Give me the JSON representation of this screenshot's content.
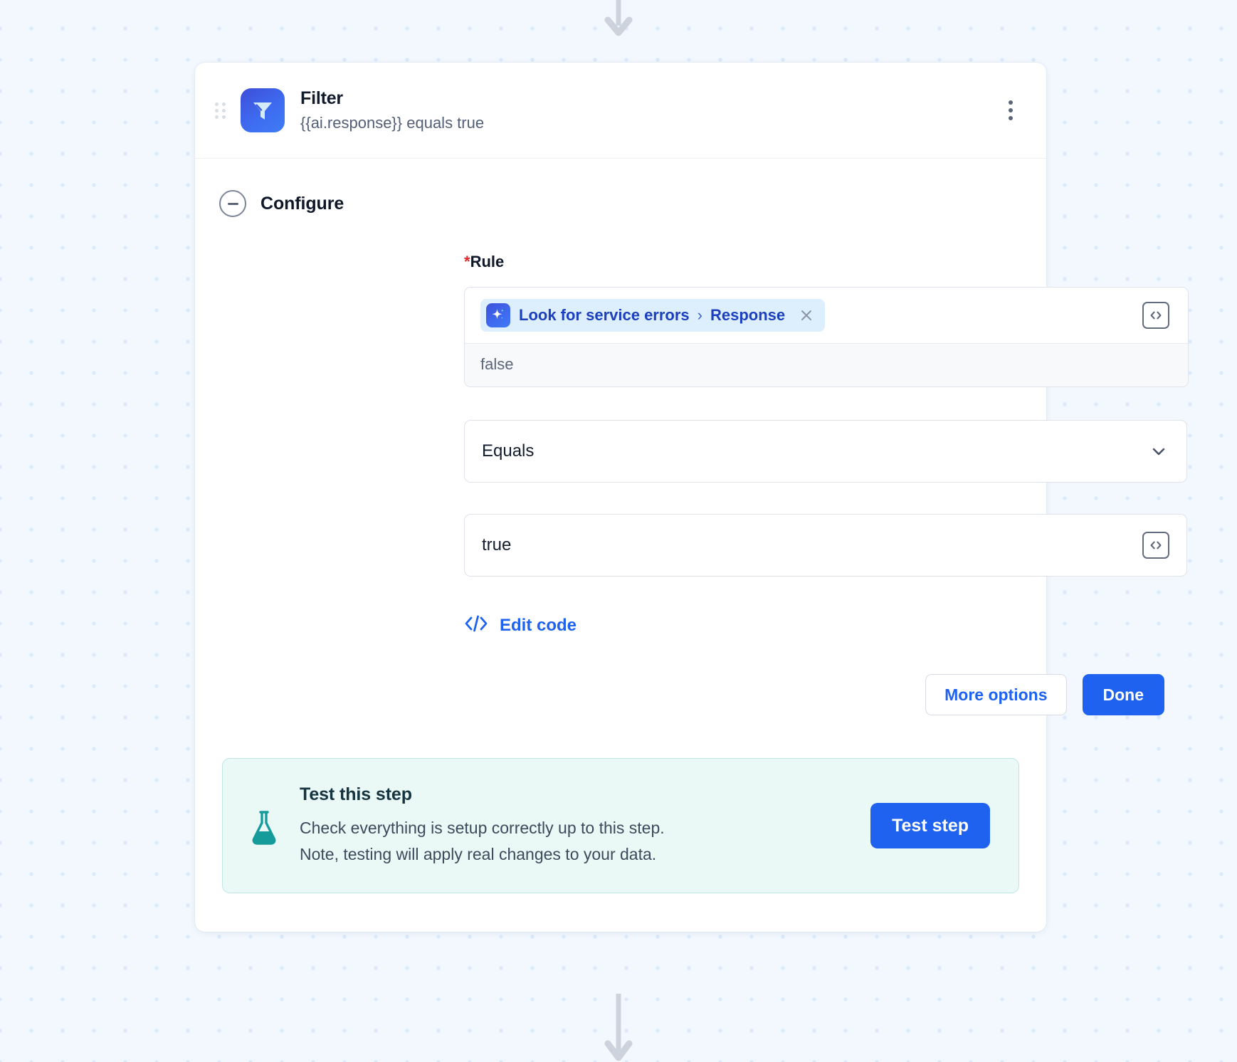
{
  "canvas": {
    "incoming_arrow": "arrow-down-icon",
    "outgoing_arrow": "arrow-down-icon"
  },
  "step_card": {
    "drag_handle": "drag-handle-icon",
    "icon": "filter-icon",
    "title": "Filter",
    "subtitle": "{{ai.response}} equals true",
    "menu": "kebab-menu-icon"
  },
  "configure": {
    "collapse_icon": "minus-circle-icon",
    "label": "Configure",
    "rule": {
      "required_marker": "*",
      "label": "Rule",
      "token": {
        "icon": "ai-sparkle-icon",
        "source": "Look for service errors",
        "separator": "›",
        "field": "Response",
        "remove_icon": "close-icon"
      },
      "code_toggle_icon": "code-brackets-icon",
      "preview_value": "false"
    },
    "operator": {
      "value": "Equals",
      "chevron_icon": "chevron-down-icon"
    },
    "comparison": {
      "value": "true",
      "code_toggle_icon": "code-brackets-icon"
    },
    "edit_code": {
      "icon": "code-tags-icon",
      "label": "Edit code"
    },
    "buttons": {
      "more_options": "More options",
      "done": "Done"
    }
  },
  "test_panel": {
    "icon": "flask-icon",
    "title": "Test this step",
    "description_line1": "Check everything is setup correctly up to this step.",
    "description_line2": "Note, testing will apply real changes to your data.",
    "button": "Test step"
  },
  "colors": {
    "accent_blue": "#1f62f0",
    "token_blue": "#1b3fbd",
    "token_bg": "#ddeefd",
    "teal_panel_bg": "#eaf8f6",
    "teal_icon": "#169b9b",
    "required_red": "#e0262b",
    "canvas_bg": "#f2f8fe"
  }
}
